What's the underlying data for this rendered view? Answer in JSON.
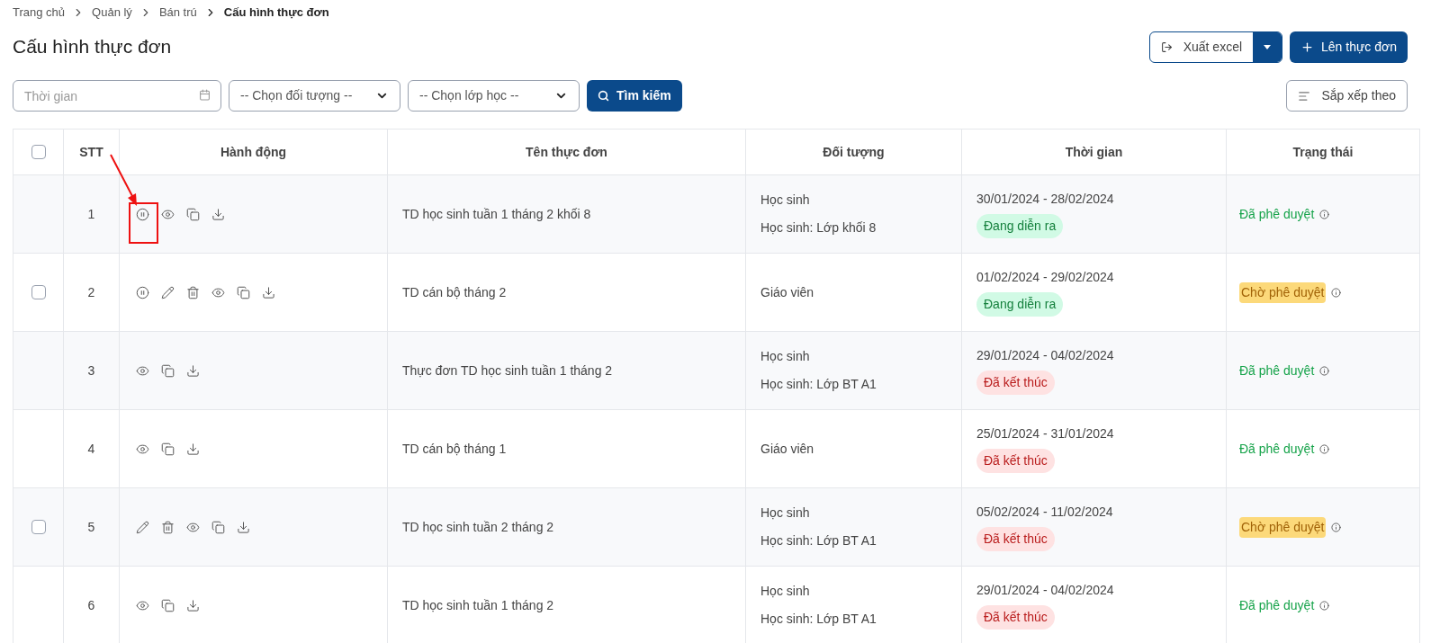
{
  "breadcrumb": [
    {
      "label": "Trang chủ",
      "current": false
    },
    {
      "label": "Quản lý",
      "current": false
    },
    {
      "label": "Bán trú",
      "current": false
    },
    {
      "label": "Cấu hình thực đơn",
      "current": true
    }
  ],
  "title": "Cấu hình thực đơn",
  "actions": {
    "export": "Xuất excel",
    "create": "Lên thực đơn",
    "sort": "Sắp xếp theo"
  },
  "filters": {
    "time": {
      "placeholder": "Thời gian"
    },
    "subject": "-- Chọn đối tượng --",
    "class": "-- Chọn lớp học --",
    "search": "Tìm kiếm"
  },
  "table": {
    "header_checked": false,
    "columns": [
      "STT",
      "Hành động",
      "Tên thực đơn",
      "Đối tượng",
      "Thời gian",
      "Trạng thái"
    ],
    "rows": [
      {
        "no": "1",
        "actions": [
          {
            "kind": "pause"
          },
          {
            "kind": "view"
          },
          {
            "kind": "copy"
          },
          {
            "kind": "download"
          }
        ],
        "name": "TD học sinh tuần 1 tháng 2 khối 8",
        "subjects": [
          "Học sinh",
          "Học sinh: Lớp khối 8"
        ],
        "period": "30/01/2024 - 28/02/2024",
        "period_tag": {
          "kind": "ongoing",
          "label": "Đang diễn ra"
        },
        "status": {
          "kind": "approved",
          "label": "Đã phê duyệt"
        }
      },
      {
        "checkbox": {
          "checked": false
        },
        "no": "2",
        "actions": [
          {
            "kind": "pause"
          },
          {
            "kind": "edit"
          },
          {
            "kind": "delete"
          },
          {
            "kind": "view"
          },
          {
            "kind": "copy"
          },
          {
            "kind": "download"
          }
        ],
        "name": "TD cán bộ tháng 2",
        "subjects": [
          "Giáo viên"
        ],
        "period": "01/02/2024 - 29/02/2024",
        "period_tag": {
          "kind": "ongoing",
          "label": "Đang diễn ra"
        },
        "status": {
          "kind": "pending",
          "label": "Chờ phê duyệt"
        }
      },
      {
        "no": "3",
        "actions": [
          {
            "kind": "view"
          },
          {
            "kind": "copy"
          },
          {
            "kind": "download"
          }
        ],
        "name": "Thực đơn TD học sinh tuần 1 tháng 2",
        "subjects": [
          "Học sinh",
          "Học sinh: Lớp BT A1"
        ],
        "period": "29/01/2024 - 04/02/2024",
        "period_tag": {
          "kind": "ended",
          "label": "Đã kết thúc"
        },
        "status": {
          "kind": "approved",
          "label": "Đã phê duyệt"
        }
      },
      {
        "no": "4",
        "actions": [
          {
            "kind": "view"
          },
          {
            "kind": "copy"
          },
          {
            "kind": "download"
          }
        ],
        "name": "TD cán bộ tháng 1",
        "subjects": [
          "Giáo viên"
        ],
        "period": "25/01/2024 - 31/01/2024",
        "period_tag": {
          "kind": "ended",
          "label": "Đã kết thúc"
        },
        "status": {
          "kind": "approved",
          "label": "Đã phê duyệt"
        }
      },
      {
        "checkbox": {
          "checked": false
        },
        "no": "5",
        "actions": [
          {
            "kind": "edit"
          },
          {
            "kind": "delete"
          },
          {
            "kind": "view"
          },
          {
            "kind": "copy"
          },
          {
            "kind": "download"
          }
        ],
        "name": "TD học sinh tuần 2 tháng 2",
        "subjects": [
          "Học sinh",
          "Học sinh: Lớp BT A1"
        ],
        "period": "05/02/2024 - 11/02/2024",
        "period_tag": {
          "kind": "ended",
          "label": "Đã kết thúc"
        },
        "status": {
          "kind": "pending",
          "label": "Chờ phê duyệt"
        }
      },
      {
        "no": "6",
        "actions": [
          {
            "kind": "view"
          },
          {
            "kind": "copy"
          },
          {
            "kind": "download"
          }
        ],
        "name": "TD học sinh tuần 1 tháng 2",
        "subjects": [
          "Học sinh",
          "Học sinh: Lớp BT A1"
        ],
        "period": "29/01/2024 - 04/02/2024",
        "period_tag": {
          "kind": "ended",
          "label": "Đã kết thúc"
        },
        "status": {
          "kind": "approved",
          "label": "Đã phê duyệt"
        }
      }
    ]
  }
}
